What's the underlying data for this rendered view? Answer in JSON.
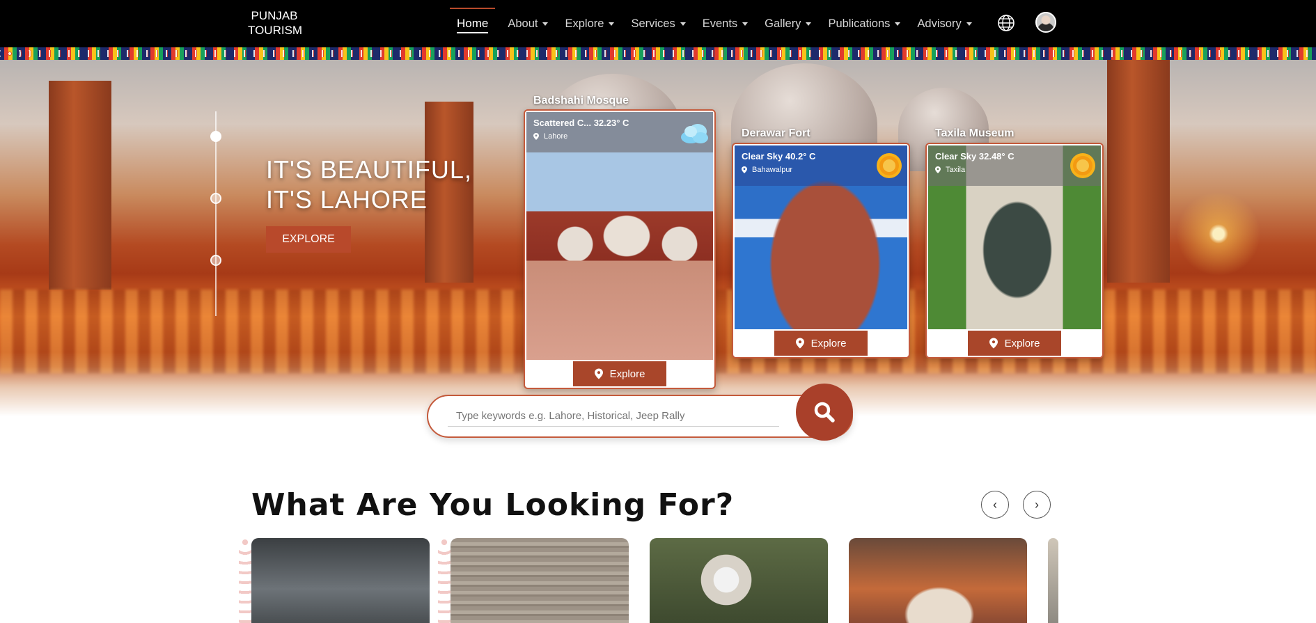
{
  "brand": {
    "line1": "PUNJAB",
    "line2": "TOURISM"
  },
  "nav": {
    "items": [
      {
        "label": "Home",
        "active": true,
        "dropdown": false
      },
      {
        "label": "About",
        "dropdown": true
      },
      {
        "label": "Explore",
        "dropdown": true
      },
      {
        "label": "Services",
        "dropdown": true
      },
      {
        "label": "Events",
        "dropdown": true
      },
      {
        "label": "Gallery",
        "dropdown": true
      },
      {
        "label": "Publications",
        "dropdown": true
      },
      {
        "label": "Advisory",
        "dropdown": true
      }
    ],
    "icons": [
      "globe-icon",
      "user-avatar"
    ]
  },
  "hero": {
    "title_line1": "IT'S BEAUTIFUL,",
    "title_line2": "IT'S LAHORE",
    "explore_label": "EXPLORE",
    "active_slide": 1,
    "slide_count": 3
  },
  "cards": [
    {
      "title": "Badshahi Mosque",
      "weather": "Scattered C... 32.23° C",
      "location": "Lahore",
      "weather_icon": "cloud-icon",
      "button": "Explore"
    },
    {
      "title": "Derawar Fort",
      "weather": "Clear Sky 40.2° C",
      "location": "Bahawalpur",
      "weather_icon": "sun-icon",
      "button": "Explore"
    },
    {
      "title": "Taxila Museum",
      "weather": "Clear Sky 32.48° C",
      "location": "Taxila",
      "weather_icon": "sun-icon",
      "button": "Explore"
    }
  ],
  "search": {
    "placeholder": "Type keywords e.g. Lahore, Historical, Jeep Rally",
    "value": ""
  },
  "section": {
    "title": "What Are You Looking For?",
    "prev_label": "‹",
    "next_label": "›"
  },
  "colors": {
    "accent": "#a9462a",
    "nav_bg": "#000000",
    "white": "#ffffff"
  }
}
